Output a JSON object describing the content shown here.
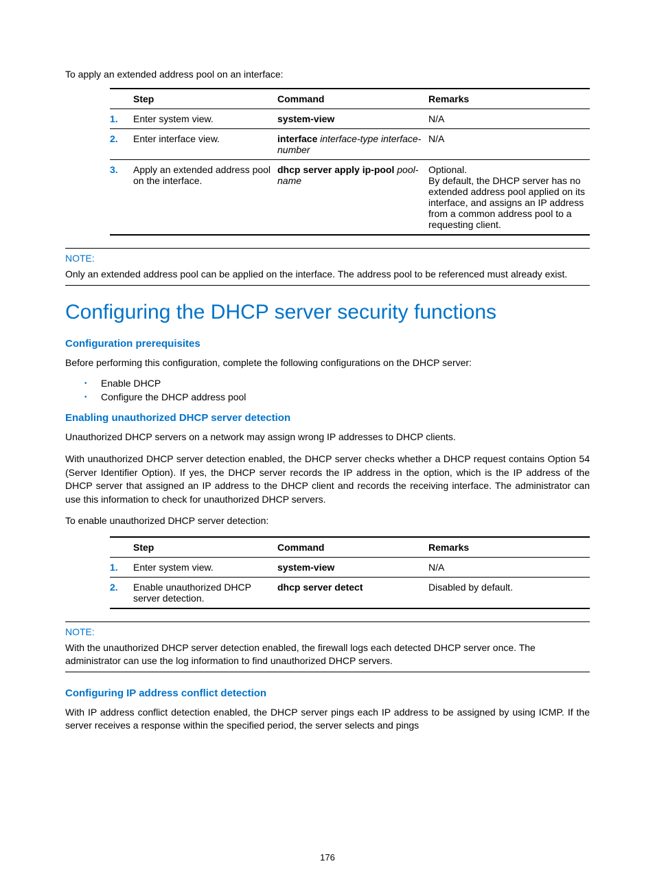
{
  "intro1": "To apply an extended address pool on an interface:",
  "table1": {
    "headers": {
      "step": "Step",
      "command": "Command",
      "remarks": "Remarks"
    },
    "rows": [
      {
        "num": "1.",
        "step": "Enter system view.",
        "cmd_bold": "system-view",
        "cmd_ital": "",
        "remarks": "N/A"
      },
      {
        "num": "2.",
        "step": "Enter interface view.",
        "cmd_bold": "interface",
        "cmd_ital": " interface-type interface-number",
        "remarks": "N/A"
      },
      {
        "num": "3.",
        "step": "Apply an extended address pool on the interface.",
        "cmd_bold": "dhcp server apply ip-pool",
        "cmd_ital": " pool-name",
        "remarks": "Optional.\nBy default, the DHCP server has no extended address pool applied on its interface, and assigns an IP address from a common address pool to a requesting client."
      }
    ]
  },
  "note1": {
    "label": "NOTE:",
    "text": "Only an extended address pool can be applied on the interface. The address pool to be referenced must already exist."
  },
  "heading1": "Configuring the DHCP server security functions",
  "subhead1": "Configuration prerequisites",
  "prereq_intro": "Before performing this configuration, complete the following configurations on the DHCP server:",
  "prereq_bullets": [
    "Enable DHCP",
    "Configure the DHCP address pool"
  ],
  "subhead2": "Enabling unauthorized DHCP server detection",
  "para2a": "Unauthorized DHCP servers on a network may assign wrong IP addresses to DHCP clients.",
  "para2b": "With unauthorized DHCP server detection enabled, the DHCP server checks whether a DHCP request contains Option 54 (Server Identifier Option). If yes, the DHCP server records the IP address in the option, which is the IP address of the DHCP server that assigned an IP address to the DHCP client and records the receiving interface. The administrator can use this information to check for unauthorized DHCP servers.",
  "para2c": "To enable unauthorized DHCP server detection:",
  "table2": {
    "headers": {
      "step": "Step",
      "command": "Command",
      "remarks": "Remarks"
    },
    "rows": [
      {
        "num": "1.",
        "step": "Enter system view.",
        "cmd_bold": "system-view",
        "cmd_ital": "",
        "remarks": "N/A"
      },
      {
        "num": "2.",
        "step": "Enable unauthorized DHCP server detection.",
        "cmd_bold": "dhcp server detect",
        "cmd_ital": "",
        "remarks": "Disabled by default."
      }
    ]
  },
  "note2": {
    "label": "NOTE:",
    "text": "With the unauthorized DHCP server detection enabled, the firewall logs each detected DHCP server once. The administrator can use the log information to find unauthorized DHCP servers."
  },
  "subhead3": "Configuring IP address conflict detection",
  "para3a": "With IP address conflict detection enabled, the DHCP server pings each IP address to be assigned by using ICMP. If the server receives a response within the specified period, the server selects and pings",
  "pagenum": "176"
}
